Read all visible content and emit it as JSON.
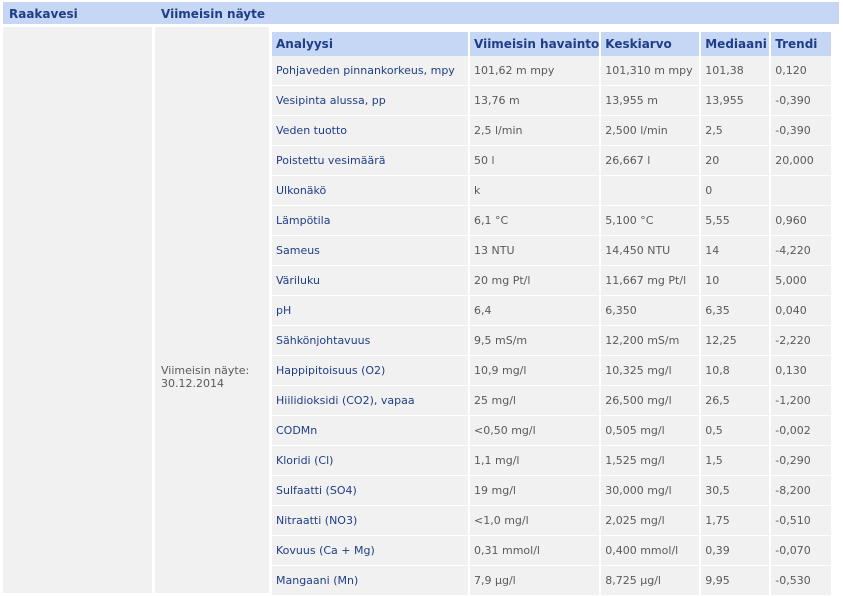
{
  "header": {
    "col1": "Raakavesi",
    "col2": "Viimeisin näyte"
  },
  "sample": {
    "label": "Viimeisin näyte:",
    "date": "30.12.2014"
  },
  "table": {
    "columns": [
      "Analyysi",
      "Viimeisin havainto",
      "Keskiarvo",
      "Mediaani",
      "Trendi"
    ],
    "rows": [
      [
        "Pohjaveden pinnankorkeus, mpy",
        "101,62 m mpy",
        "101,310 m mpy",
        "101,38",
        "0,120"
      ],
      [
        "Vesipinta alussa, pp",
        "13,76 m",
        "13,955 m",
        "13,955",
        "-0,390"
      ],
      [
        "Veden tuotto",
        "2,5 l/min",
        "2,500 l/min",
        "2,5",
        "-0,390"
      ],
      [
        "Poistettu vesimäärä",
        "50 l",
        "26,667 l",
        "20",
        "20,000"
      ],
      [
        "Ulkonäkö",
        "k",
        "",
        "0",
        ""
      ],
      [
        "Lämpötila",
        "6,1 °C",
        "5,100 °C",
        "5,55",
        "0,960"
      ],
      [
        "Sameus",
        "13 NTU",
        "14,450 NTU",
        "14",
        "-4,220"
      ],
      [
        "Väriluku",
        "20 mg Pt/l",
        "11,667 mg Pt/l",
        "10",
        "5,000"
      ],
      [
        "pH",
        "6,4",
        "6,350",
        "6,35",
        "0,040"
      ],
      [
        "Sähkönjohtavuus",
        "9,5 mS/m",
        "12,200 mS/m",
        "12,25",
        "-2,220"
      ],
      [
        "Happipitoisuus (O2)",
        "10,9 mg/l",
        "10,325 mg/l",
        "10,8",
        "0,130"
      ],
      [
        "Hiilidioksidi (CO2), vapaa",
        "25 mg/l",
        "26,500 mg/l",
        "26,5",
        "-1,200"
      ],
      [
        "CODMn",
        "<0,50 mg/l",
        "0,505 mg/l",
        "0,5",
        "-0,002"
      ],
      [
        "Kloridi (Cl)",
        "1,1 mg/l",
        "1,525 mg/l",
        "1,5",
        "-0,290"
      ],
      [
        "Sulfaatti (SO4)",
        "19 mg/l",
        "30,000 mg/l",
        "30,5",
        "-8,200"
      ],
      [
        "Nitraatti (NO3)",
        "<1,0 mg/l",
        "2,025 mg/l",
        "1,75",
        "-0,510"
      ],
      [
        "Kovuus (Ca + Mg)",
        "0,31 mmol/l",
        "0,400 mmol/l",
        "0,39",
        "-0,070"
      ],
      [
        "Mangaani (Mn)",
        "7,9 µg/l",
        "8,725 µg/l",
        "9,95",
        "-0,530"
      ]
    ]
  },
  "colors": {
    "header_bg": "#c6d7f5",
    "header_text": "#1f3e87",
    "row_bg": "#f1f1f1",
    "value_text": "#5a5a5a",
    "name_text": "#1f3e87"
  }
}
